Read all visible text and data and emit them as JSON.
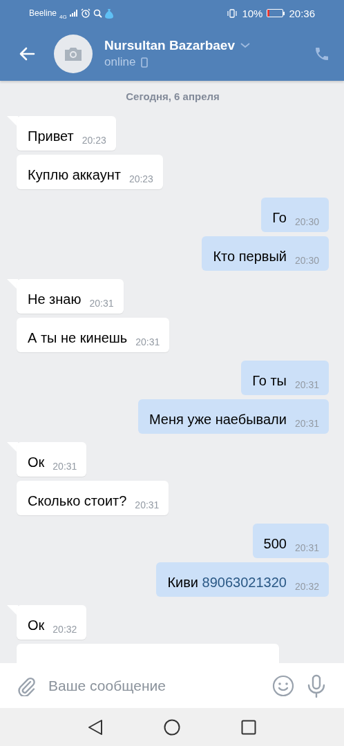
{
  "status_bar": {
    "carrier": "Beeline",
    "network": "4G",
    "battery_text": "10%",
    "time": "20:36"
  },
  "header": {
    "name": "Nursultan Bazarbaev",
    "status": "online"
  },
  "date_divider": "Сегодня, 6 апреля",
  "messages": [
    {
      "kind": "incoming",
      "tail": true,
      "text": "Привет",
      "time": "20:23"
    },
    {
      "kind": "incoming",
      "tail": false,
      "text": "Куплю аккаунт",
      "time": "20:23"
    },
    {
      "kind": "outgoing",
      "tail": false,
      "text": "Го",
      "time": "20:30"
    },
    {
      "kind": "outgoing",
      "tail": false,
      "text": "Кто первый",
      "time": "20:30"
    },
    {
      "kind": "incoming",
      "tail": true,
      "text": "Не знаю",
      "time": "20:31"
    },
    {
      "kind": "incoming",
      "tail": false,
      "text": "А ты не кинешь",
      "time": "20:31"
    },
    {
      "kind": "outgoing",
      "tail": false,
      "text": "Го ты",
      "time": "20:31"
    },
    {
      "kind": "outgoing",
      "tail": false,
      "text": "Меня уже наебывали",
      "time": "20:31"
    },
    {
      "kind": "incoming",
      "tail": true,
      "text": "Ок",
      "time": "20:31"
    },
    {
      "kind": "incoming",
      "tail": false,
      "text": "Сколько стоит?",
      "time": "20:31"
    },
    {
      "kind": "outgoing",
      "tail": false,
      "text": "500",
      "time": "20:31"
    },
    {
      "kind": "outgoing",
      "tail": false,
      "text": "Киви",
      "link": "89063021320",
      "time": "20:32"
    },
    {
      "kind": "incoming",
      "tail": true,
      "text": "Ок",
      "time": "20:32"
    },
    {
      "kind": "incoming-cut",
      "tail": false
    }
  ],
  "composer": {
    "placeholder": "Ваше сообщение"
  }
}
